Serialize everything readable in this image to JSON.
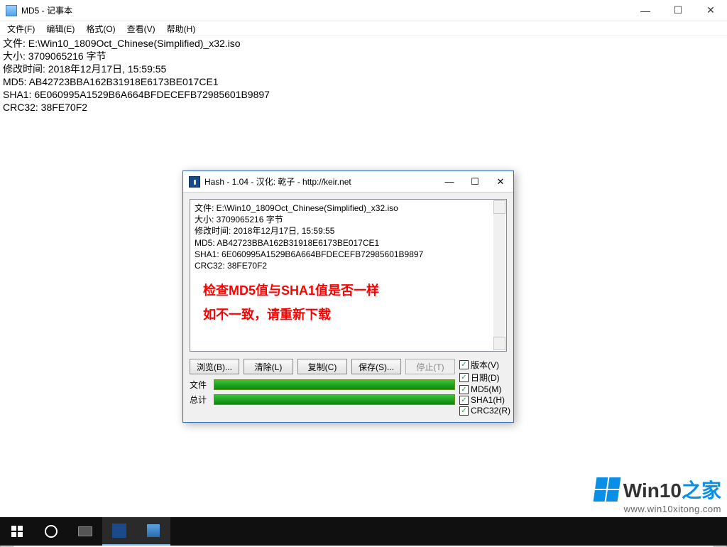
{
  "notepad": {
    "title": "MD5 - 记事本",
    "menu": {
      "file": "文件(F)",
      "edit": "编辑(E)",
      "format": "格式(O)",
      "view": "查看(V)",
      "help": "帮助(H)"
    },
    "lines": {
      "l1": "文件: E:\\Win10_1809Oct_Chinese(Simplified)_x32.iso",
      "l2": "大小: 3709065216 字节",
      "l3": "修改时间: 2018年12月17日, 15:59:55",
      "l4": "MD5: AB42723BBA162B31918E6173BE017CE1",
      "l5": "SHA1: 6E060995A1529B6A664BFDECEFB72985601B9897",
      "l6": "CRC32: 38FE70F2"
    }
  },
  "hash": {
    "title": "Hash - 1.04 - 汉化: 乾子 - http://keir.net",
    "lines": {
      "l1": "文件: E:\\Win10_1809Oct_Chinese(Simplified)_x32.iso",
      "l2": "大小: 3709065216 字节",
      "l3": "修改时间: 2018年12月17日, 15:59:55",
      "l4": "MD5: AB42723BBA162B31918E6173BE017CE1",
      "l5": "SHA1: 6E060995A1529B6A664BFDECEFB72985601B9897",
      "l6": "CRC32: 38FE70F2"
    },
    "overlay": {
      "line1": "检查MD5值与SHA1值是否一样",
      "line2": "如不一致，请重新下载"
    },
    "buttons": {
      "browse": "浏览(B)...",
      "clear": "清除(L)",
      "copy": "复制(C)",
      "save": "保存(S)...",
      "stop": "停止(T)"
    },
    "checks": {
      "version": "版本(V)",
      "date": "日期(D)",
      "md5": "MD5(M)",
      "sha1": "SHA1(H)",
      "crc32": "CRC32(R)"
    },
    "progress": {
      "file_label": "文件",
      "total_label": "总计"
    }
  },
  "watermark": {
    "brand_a": "Win10",
    "brand_b": "之家",
    "url": "www.win10xitong.com"
  }
}
